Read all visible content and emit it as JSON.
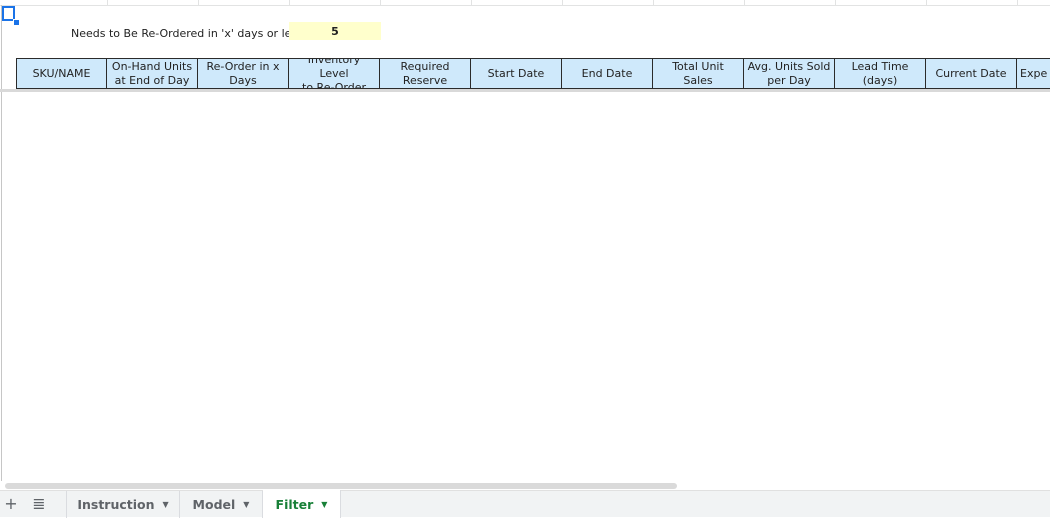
{
  "sheet": {
    "param_label": "Needs to Be Re-Ordered in 'x' days or less",
    "param_value": "5",
    "headers": [
      {
        "line1": "SKU/NAME",
        "line2": ""
      },
      {
        "line1": "On-Hand Units",
        "line2": "at End of Day"
      },
      {
        "line1": "Re-Order in x",
        "line2": "Days"
      },
      {
        "line1": "Inventory Level",
        "line2": "to Re-Order"
      },
      {
        "line1": "Required",
        "line2": "Reserve"
      },
      {
        "line1": "Start Date",
        "line2": ""
      },
      {
        "line1": "End Date",
        "line2": ""
      },
      {
        "line1": "Total Unit Sales",
        "line2": ""
      },
      {
        "line1": "Avg. Units Sold",
        "line2": "per Day"
      },
      {
        "line1": "Lead Time",
        "line2": "(days)"
      },
      {
        "line1": "Current Date",
        "line2": ""
      },
      {
        "line1": "Expe",
        "line2": ""
      }
    ]
  },
  "tabbar": {
    "add_icon": "plus-icon",
    "list_icon": "list-icon",
    "tabs": [
      {
        "label": "Instruction",
        "active": false
      },
      {
        "label": "Model",
        "active": false
      },
      {
        "label": "Filter",
        "active": true
      }
    ]
  },
  "colors": {
    "header_fill": "#cfe9fb",
    "param_fill": "#ffffcc",
    "active_tab_text": "#188038",
    "selection": "#1a73e8"
  }
}
